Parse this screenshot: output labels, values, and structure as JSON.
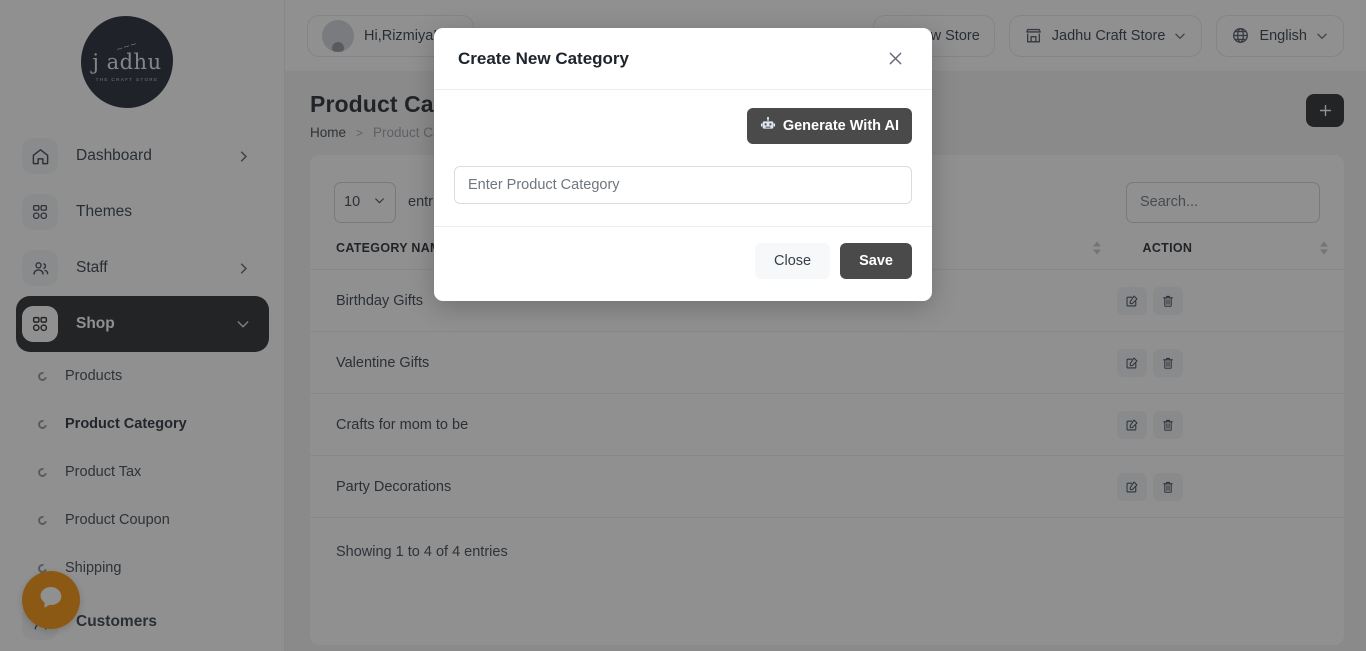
{
  "sidebar": {
    "logo": {
      "name": "j adhu",
      "tagline": "THE CRAFT STORE",
      "squiggle": "~~~"
    },
    "items": [
      {
        "label": "Dashboard",
        "icon": "home-icon",
        "has_chevron": true
      },
      {
        "label": "Themes",
        "icon": "grid-icon",
        "has_chevron": false
      },
      {
        "label": "Staff",
        "icon": "users-icon",
        "has_chevron": true
      },
      {
        "label": "Shop",
        "icon": "grid-icon",
        "has_chevron": true,
        "active": true
      }
    ],
    "sub_items": [
      {
        "label": "Products",
        "current": false
      },
      {
        "label": "Product Category",
        "current": true
      },
      {
        "label": "Product Tax",
        "current": false
      },
      {
        "label": "Product Coupon",
        "current": false
      },
      {
        "label": "Shipping",
        "current": false
      }
    ],
    "trailing_items": [
      {
        "label": "Customers",
        "icon": "users-icon"
      }
    ]
  },
  "topbar": {
    "greeting": "Hi,Rizmiya!",
    "new_store_label": "New Store",
    "store_name": "Jadhu Craft Store",
    "language": "English"
  },
  "page": {
    "title": "Product Category",
    "breadcrumb_home": "Home",
    "breadcrumb_separator": ">",
    "breadcrumb_current": "Product Category",
    "add_button_glyph": "+"
  },
  "table": {
    "length_value": "10",
    "length_label": "entries",
    "search_placeholder": "Search...",
    "columns": [
      "CATEGORY NAME",
      "ACTION"
    ],
    "rows": [
      {
        "category_name": "Birthday Gifts"
      },
      {
        "category_name": "Valentine Gifts"
      },
      {
        "category_name": "Crafts for mom to be"
      },
      {
        "category_name": "Party Decorations"
      }
    ],
    "info": "Showing 1 to 4 of 4 entries"
  },
  "modal": {
    "title": "Create New Category",
    "ai_button_label": "Generate With AI",
    "ai_button_icon": "robot-icon",
    "input_placeholder": "Enter Product Category",
    "input_value": "",
    "close_label": "Close",
    "save_label": "Save"
  },
  "chat_widget": {
    "icon": "chat-bubble-icon"
  },
  "colors": {
    "accent_dark": "#23272b",
    "button_dark": "#4a4a4a",
    "chat_orange": "#f79009",
    "overlay": "rgba(33,33,33,0.5)"
  }
}
